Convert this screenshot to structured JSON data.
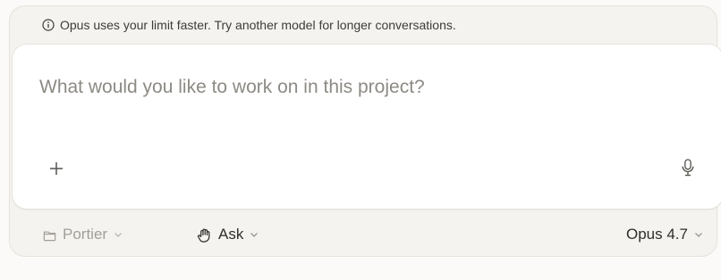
{
  "notice": {
    "text": "Opus uses your limit faster. Try another model for longer conversations.",
    "icon": "info-icon"
  },
  "composer": {
    "placeholder": "What would you like to work on in this project?",
    "value": "",
    "add_icon": "plus-icon",
    "mic_icon": "microphone-icon"
  },
  "footer": {
    "project": {
      "label": "Portier",
      "icon": "folder-icon"
    },
    "mode": {
      "label": "Ask",
      "icon": "hand-icon"
    },
    "model": {
      "label": "Opus 4.7"
    }
  },
  "colors": {
    "page_background": "#fbfaf8",
    "panel_background": "#f5f3ef",
    "card_background": "#ffffff",
    "muted_text": "#a29f99",
    "text": "#2f2e2b"
  }
}
